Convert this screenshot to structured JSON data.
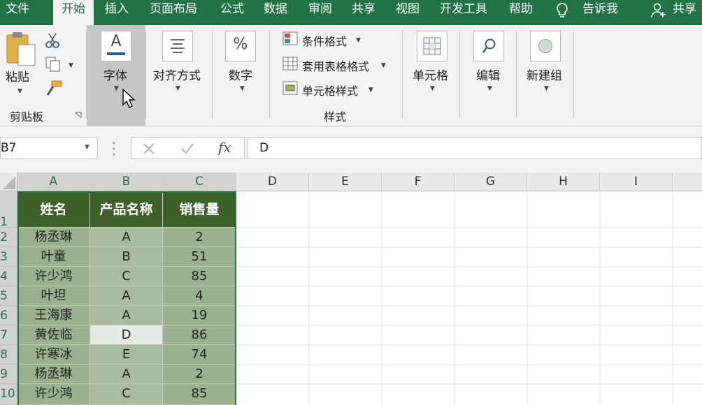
{
  "menu": {
    "tabs": [
      "文件",
      "开始",
      "插入",
      "页面布局",
      "公式",
      "数据",
      "审阅",
      "共享",
      "视图",
      "开发工具",
      "帮助"
    ],
    "active_tab": "开始",
    "tell_me": "告诉我",
    "share": "共享"
  },
  "ribbon": {
    "clipboard": {
      "paste": "粘贴",
      "group_label": "剪贴板"
    },
    "font": {
      "label": "字体",
      "icon_letter": "A"
    },
    "alignment": {
      "label": "对齐方式"
    },
    "number": {
      "label": "数字",
      "icon_symbol": "%"
    },
    "styles": {
      "conditional": "条件格式",
      "table_format": "套用表格格式",
      "cell_style": "单元格样式",
      "group_label": "样式"
    },
    "cells": {
      "label": "单元格"
    },
    "editing": {
      "label": "编辑"
    },
    "new_group": {
      "label": "新建组"
    }
  },
  "formula_bar": {
    "name_box": "B7",
    "fx": "fx",
    "value": "D"
  },
  "sheet": {
    "columns": [
      "A",
      "B",
      "C",
      "D",
      "E",
      "F",
      "G",
      "H",
      "I"
    ],
    "rows": [
      "1",
      "2",
      "3",
      "4",
      "5",
      "6",
      "7",
      "8",
      "9",
      "10"
    ],
    "header": [
      "姓名",
      "产品名称",
      "销售量"
    ],
    "data": [
      [
        "杨丞琳",
        "A",
        "2"
      ],
      [
        "叶童",
        "B",
        "51"
      ],
      [
        "许少鸿",
        "C",
        "85"
      ],
      [
        "叶坦",
        "A",
        "4"
      ],
      [
        "王海康",
        "A",
        "19"
      ],
      [
        "黄佐临",
        "D",
        "86"
      ],
      [
        "许寒冰",
        "E",
        "74"
      ],
      [
        "杨丞琳",
        "A",
        "2"
      ],
      [
        "许少鸿",
        "C",
        "85"
      ]
    ],
    "active_cell": "B7"
  },
  "colors": {
    "brand": "#217346",
    "table_header": "#3d6129",
    "table_body": "#9bb08d"
  }
}
